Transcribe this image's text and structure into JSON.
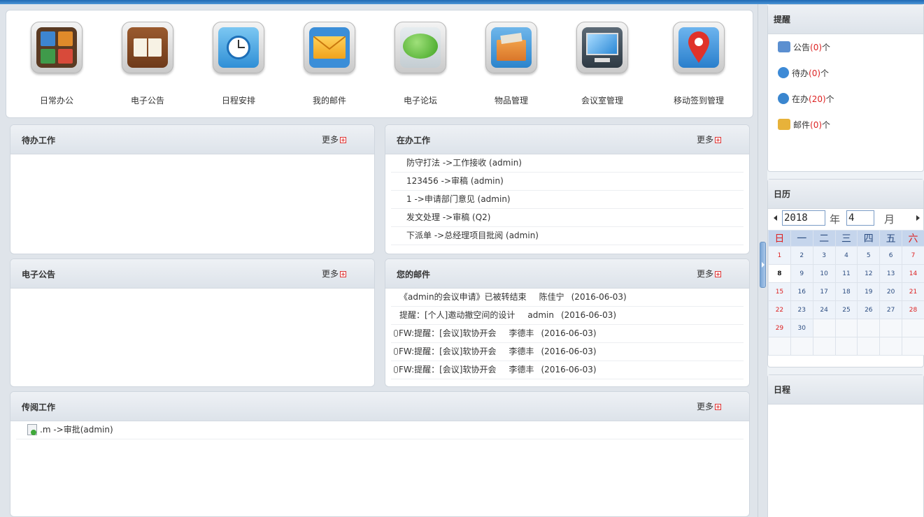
{
  "apps": [
    {
      "label": "日常办公",
      "icon": "office-grid-icon"
    },
    {
      "label": "电子公告",
      "icon": "book-icon"
    },
    {
      "label": "日程安排",
      "icon": "alarm-clock-icon"
    },
    {
      "label": "我的邮件",
      "icon": "envelope-icon"
    },
    {
      "label": "电子论坛",
      "icon": "speech-bubble-icon"
    },
    {
      "label": "物品管理",
      "icon": "box-icon"
    },
    {
      "label": "会议室管理",
      "icon": "monitor-icon"
    },
    {
      "label": "移动签到管理",
      "icon": "map-pin-icon"
    }
  ],
  "more_label": "更多",
  "todo": {
    "title": "待办工作"
  },
  "inprogress": {
    "title": "在办工作",
    "items": [
      "防守打法 ->工作接收 (admin)",
      "123456 ->审稿 (admin)",
      "1 ->申请部门意见 (admin)",
      "发文处理 ->审稿 (Q2)",
      "下派单 ->总经理项目批阅 (admin)"
    ]
  },
  "notice": {
    "title": "电子公告"
  },
  "mail": {
    "title": "您的邮件",
    "items": [
      {
        "subject": "《admin的会议申请》已被转结束",
        "sender": "陈佳宁",
        "date": "(2016-06-03)",
        "attach": false
      },
      {
        "subject": "提醒：[个人]邀动撤空间的设计",
        "sender": "admin",
        "date": "(2016-06-03)",
        "attach": false
      },
      {
        "subject": "FW:提醒：[会议]软协开会",
        "sender": "李德丰",
        "date": "(2016-06-03)",
        "attach": true
      },
      {
        "subject": "FW:提醒：[会议]软协开会",
        "sender": "李德丰",
        "date": "(2016-06-03)",
        "attach": true
      },
      {
        "subject": "FW:提醒：[会议]软协开会",
        "sender": "李德丰",
        "date": "(2016-06-03)",
        "attach": true
      }
    ]
  },
  "circulate": {
    "title": "传阅工作",
    "items": [
      ".m ->审批(admin)"
    ]
  },
  "reminder": {
    "title": "提醒",
    "items": [
      {
        "name": "公告",
        "count": "(0)",
        "unit": "个",
        "color": "#5b8fd0"
      },
      {
        "name": "待办",
        "count": "(0)",
        "unit": "个",
        "color": "#3d8ad6"
      },
      {
        "name": "在办",
        "count": "(20)",
        "unit": "个",
        "color": "#3a86cf"
      },
      {
        "name": "邮件",
        "count": "(0)",
        "unit": "个",
        "color": "#e7b23a"
      }
    ]
  },
  "calendar": {
    "title": "日历",
    "year": "2018",
    "year_label": "年",
    "month": "4",
    "month_label": "月",
    "weekdays": [
      "日",
      "一",
      "二",
      "三",
      "四",
      "五",
      "六"
    ],
    "today": "8",
    "weeks": [
      [
        "1",
        "2",
        "3",
        "4",
        "5",
        "6",
        "7"
      ],
      [
        "8",
        "9",
        "10",
        "11",
        "12",
        "13",
        "14"
      ],
      [
        "15",
        "16",
        "17",
        "18",
        "19",
        "20",
        "21"
      ],
      [
        "22",
        "23",
        "24",
        "25",
        "26",
        "27",
        "28"
      ],
      [
        "29",
        "30",
        "",
        "",
        "",
        "",
        ""
      ],
      [
        "",
        "",
        "",
        "",
        "",
        "",
        ""
      ]
    ]
  },
  "schedule": {
    "title": "日程"
  }
}
